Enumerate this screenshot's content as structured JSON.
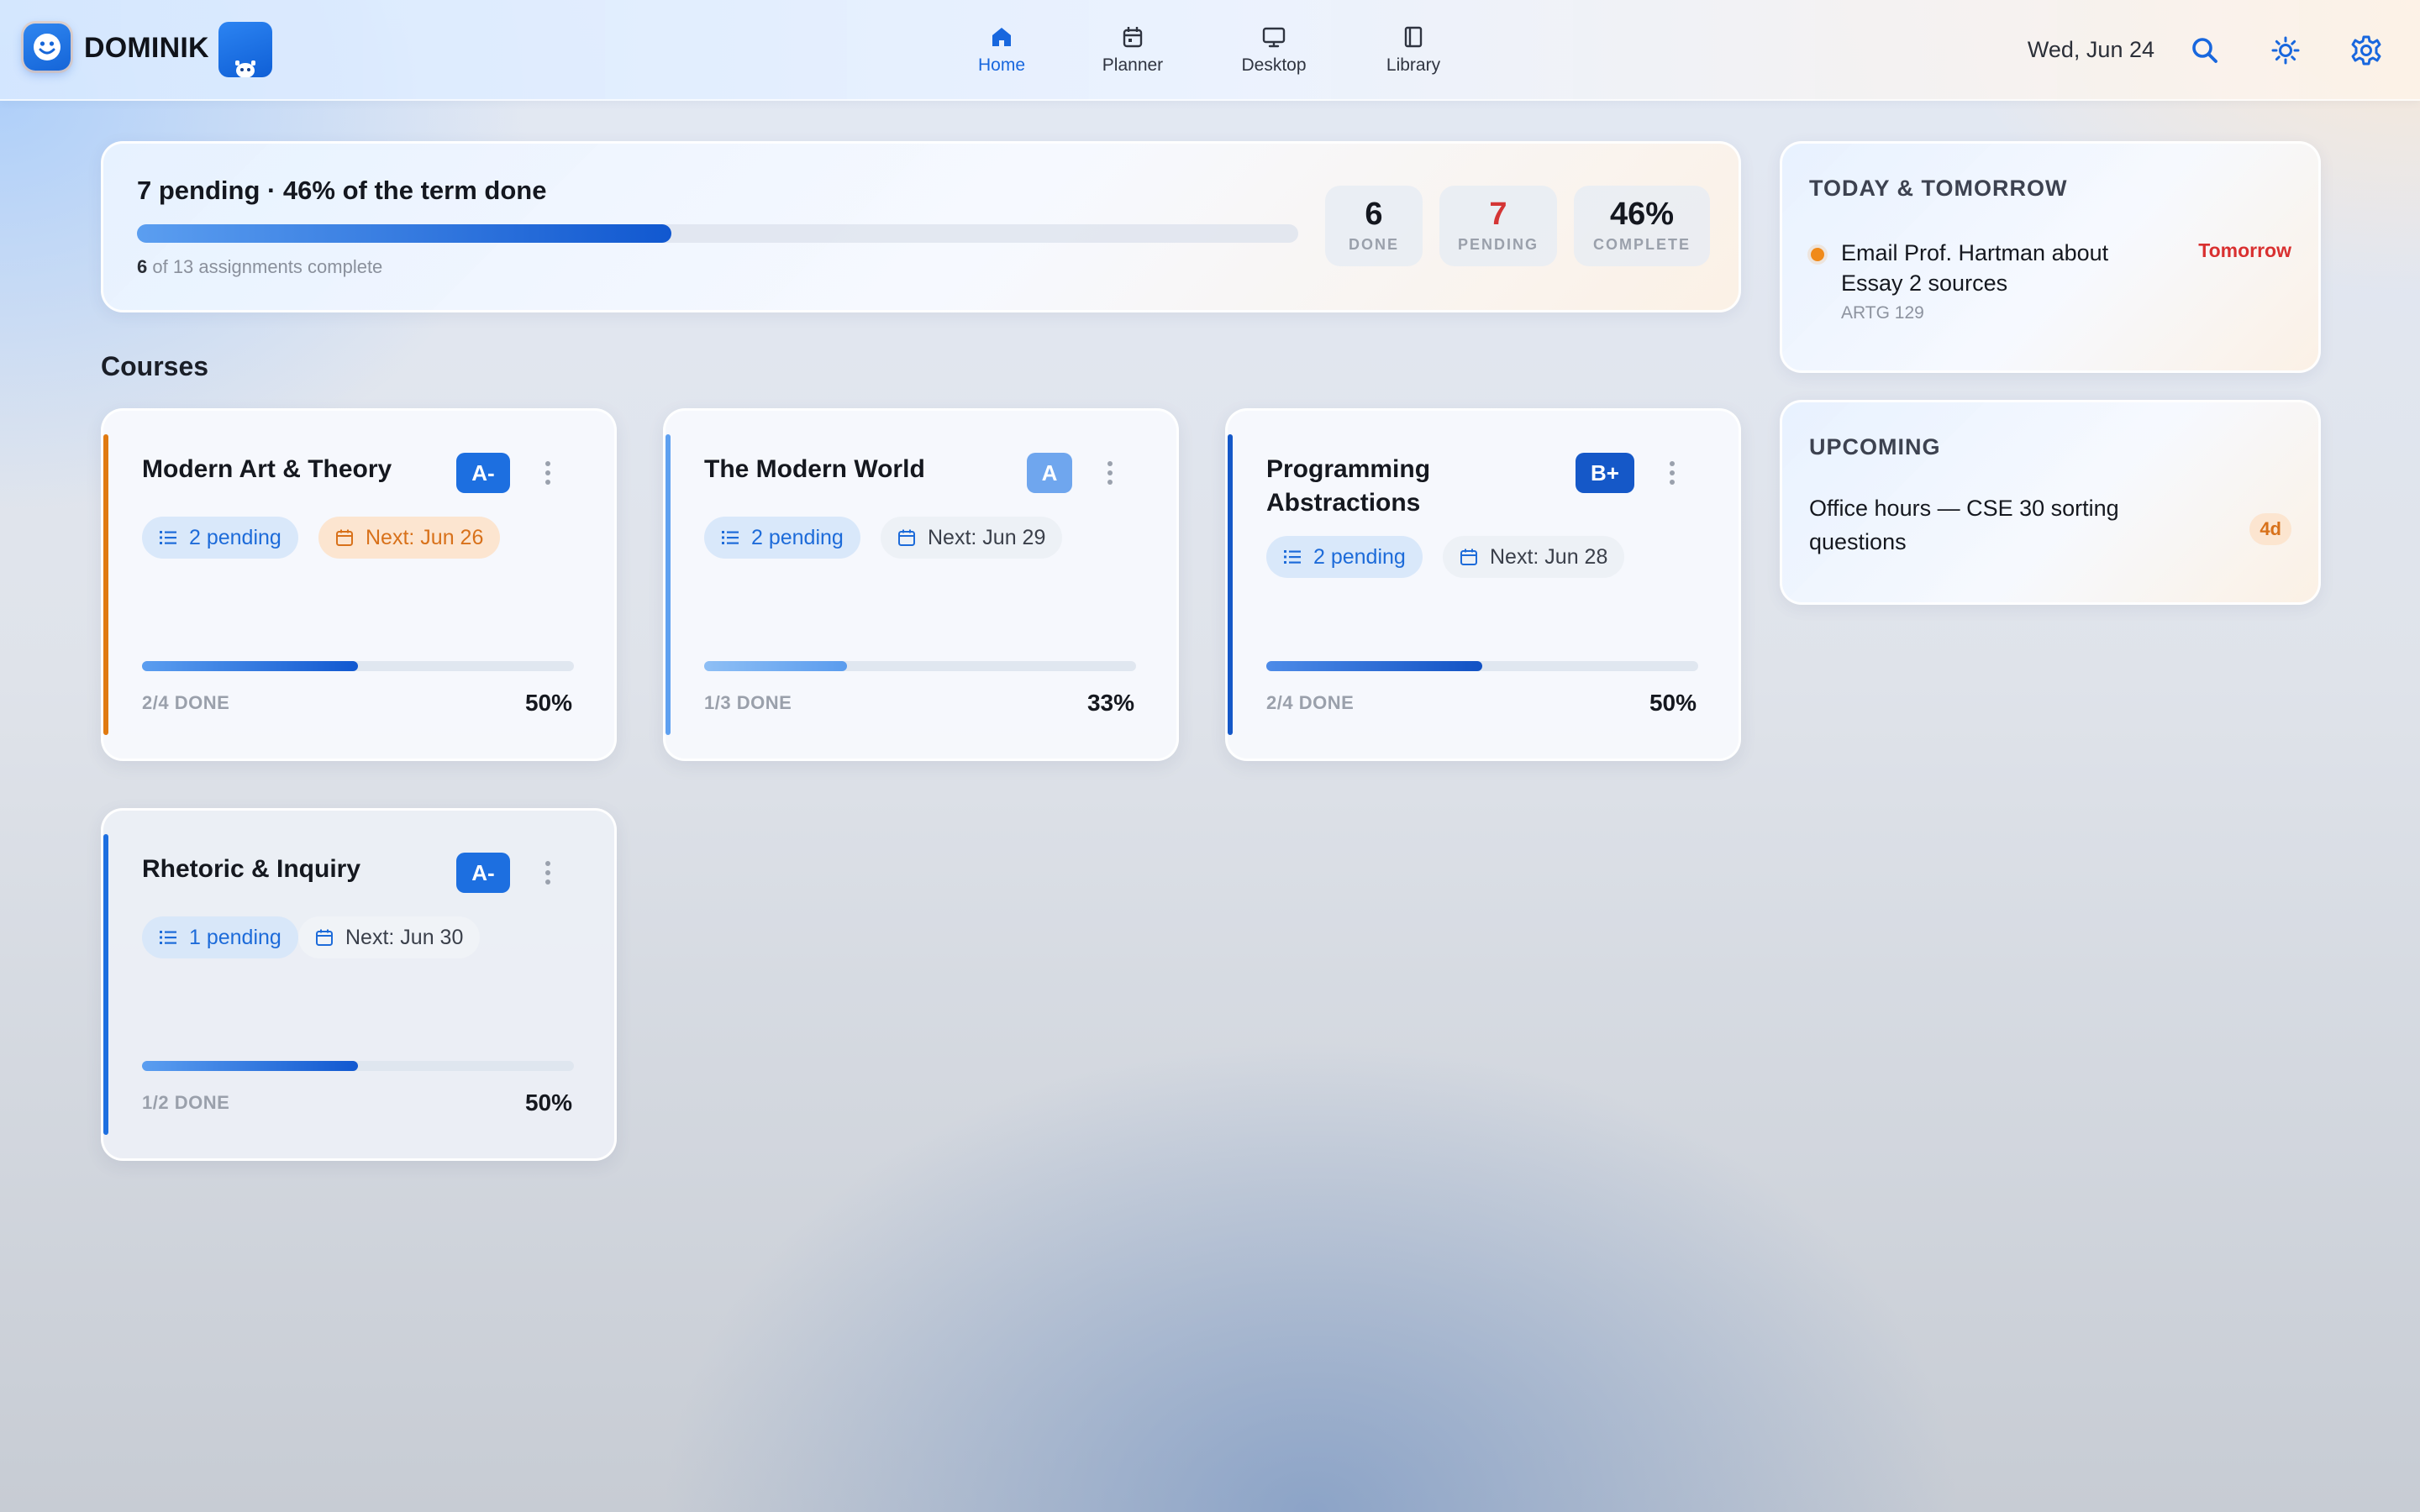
{
  "app": {
    "brand": "DOMINIK"
  },
  "nav": [
    {
      "label": "Home",
      "icon": "home-icon",
      "active": true
    },
    {
      "label": "Planner",
      "icon": "calendar-icon",
      "active": false
    },
    {
      "label": "Desktop",
      "icon": "monitor-icon",
      "active": false
    },
    {
      "label": "Library",
      "icon": "book-icon",
      "active": false
    }
  ],
  "header": {
    "date": "Wed, Jun 24"
  },
  "summary": {
    "title": "7 pending · 46% of the term done",
    "progress": 0.46,
    "done_count": "6",
    "sub_text": " of 13 assignments complete",
    "stats": [
      {
        "value": "6",
        "label": "DONE"
      },
      {
        "value": "7",
        "label": "PENDING",
        "color": "#d43535"
      },
      {
        "value": "46%",
        "label": "COMPLETE"
      }
    ]
  },
  "courses_title": "Courses",
  "courses": [
    {
      "title": "Modern Art & Theory",
      "grade": "A-",
      "grade_color": "#1d6fe0",
      "accent": "#e07a10",
      "pending": "2 pending",
      "next": "Next: Jun 26",
      "next_warn": true,
      "progress": 0.5,
      "done": "2/4 DONE",
      "percent": "50%"
    },
    {
      "title": "The Modern World",
      "grade": "A",
      "grade_color": "#6fa6ee",
      "accent": "#5ea0f0",
      "pending": "2 pending",
      "next": "Next: Jun 29",
      "next_warn": false,
      "progress": 0.33,
      "done": "1/3 DONE",
      "percent": "33%"
    },
    {
      "title": "Programming Abstractions",
      "grade": "B+",
      "grade_color": "#1558c8",
      "accent": "#1558c8",
      "pending": "2 pending",
      "next": "Next: Jun 28",
      "next_warn": false,
      "progress": 0.5,
      "done": "2/4 DONE",
      "percent": "50%"
    },
    {
      "title": "Rhetoric & Inquiry",
      "grade": "A-",
      "grade_color": "#1d6fe0",
      "accent": "#1d6fe0",
      "pending": "1 pending",
      "next": "Next: Jun 30",
      "next_warn": false,
      "progress": 0.5,
      "done": "1/2 DONE",
      "percent": "50%"
    }
  ],
  "today": {
    "title": "TODAY & TOMORROW",
    "tasks": [
      {
        "title": "Email Prof. Hartman about Essay 2 sources",
        "course": "ARTG 129",
        "when": "Tomorrow"
      }
    ]
  },
  "upcoming": {
    "title": "UPCOMING",
    "items": [
      {
        "title": "Office hours — CSE 30 sorting questions",
        "badge": "4d"
      }
    ]
  }
}
